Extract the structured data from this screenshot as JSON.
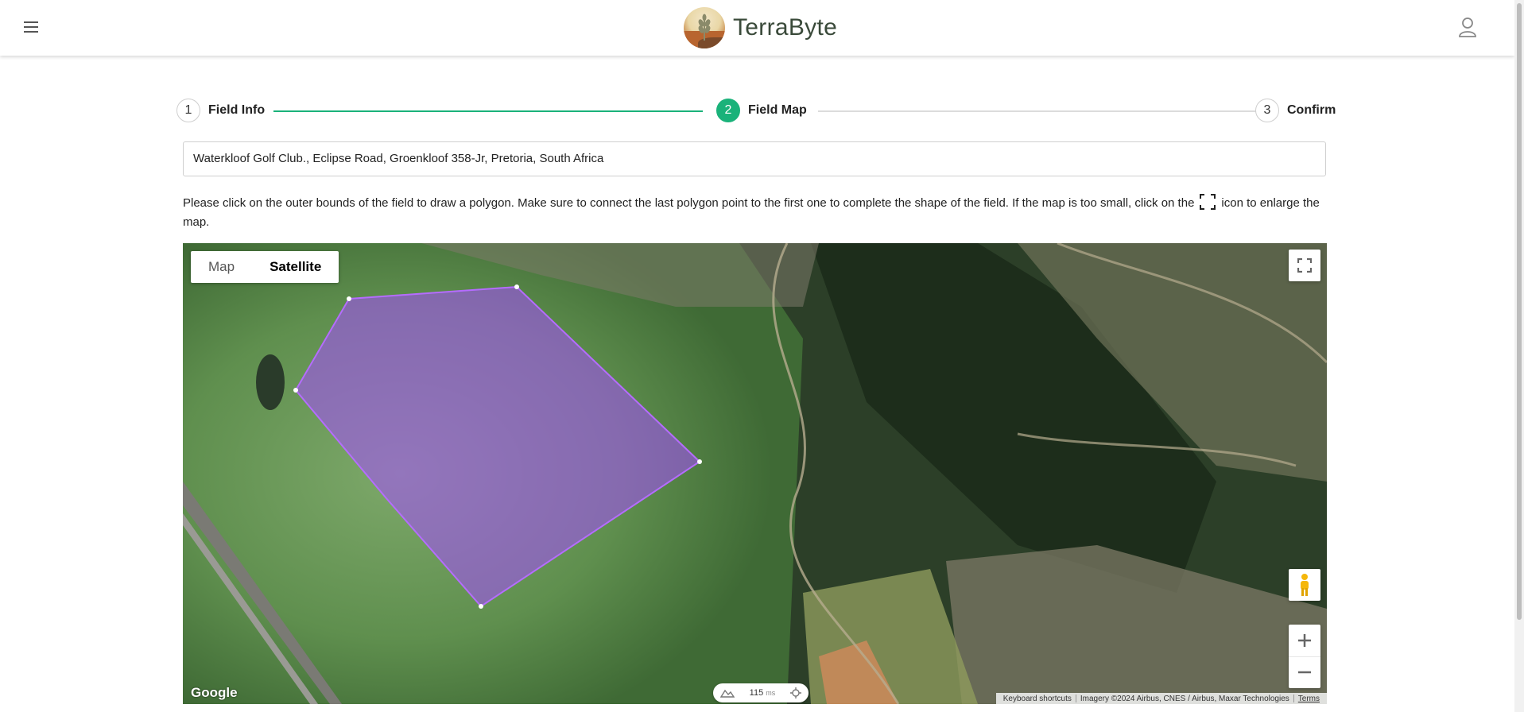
{
  "app": {
    "brand_name": "TerraByte"
  },
  "header": {
    "menu_icon": "hamburger-menu-icon",
    "profile_icon": "user-profile-icon"
  },
  "stepper": {
    "steps": [
      {
        "number": "1",
        "label": "Field Info",
        "state": "completed"
      },
      {
        "number": "2",
        "label": "Field Map",
        "state": "active"
      },
      {
        "number": "3",
        "label": "Confirm",
        "state": "upcoming"
      }
    ],
    "accent_color": "#1ab27a"
  },
  "address": {
    "value": "Waterkloof Golf Club., Eclipse Road, Groenkloof 358-Jr, Pretoria, South Africa"
  },
  "instructions": {
    "before_icon": "Please click on the outer bounds of the field to draw a polygon. Make sure to connect the last polygon point to the first one to complete the shape of the field. If the map is too small, click on the",
    "after_icon": "icon to enlarge the map.",
    "icon": "fullscreen-icon"
  },
  "map": {
    "type_map_label": "Map",
    "type_satellite_label": "Satellite",
    "selected_type": "Satellite",
    "google_label": "Google",
    "perf_value": "115",
    "perf_unit": "ms",
    "attribution": {
      "shortcuts": "Keyboard shortcuts",
      "imagery": "Imagery ©2024 Airbus, CNES / Airbus, Maxar Technologies",
      "terms": "Terms"
    },
    "polygon_color": "#a64dff"
  }
}
